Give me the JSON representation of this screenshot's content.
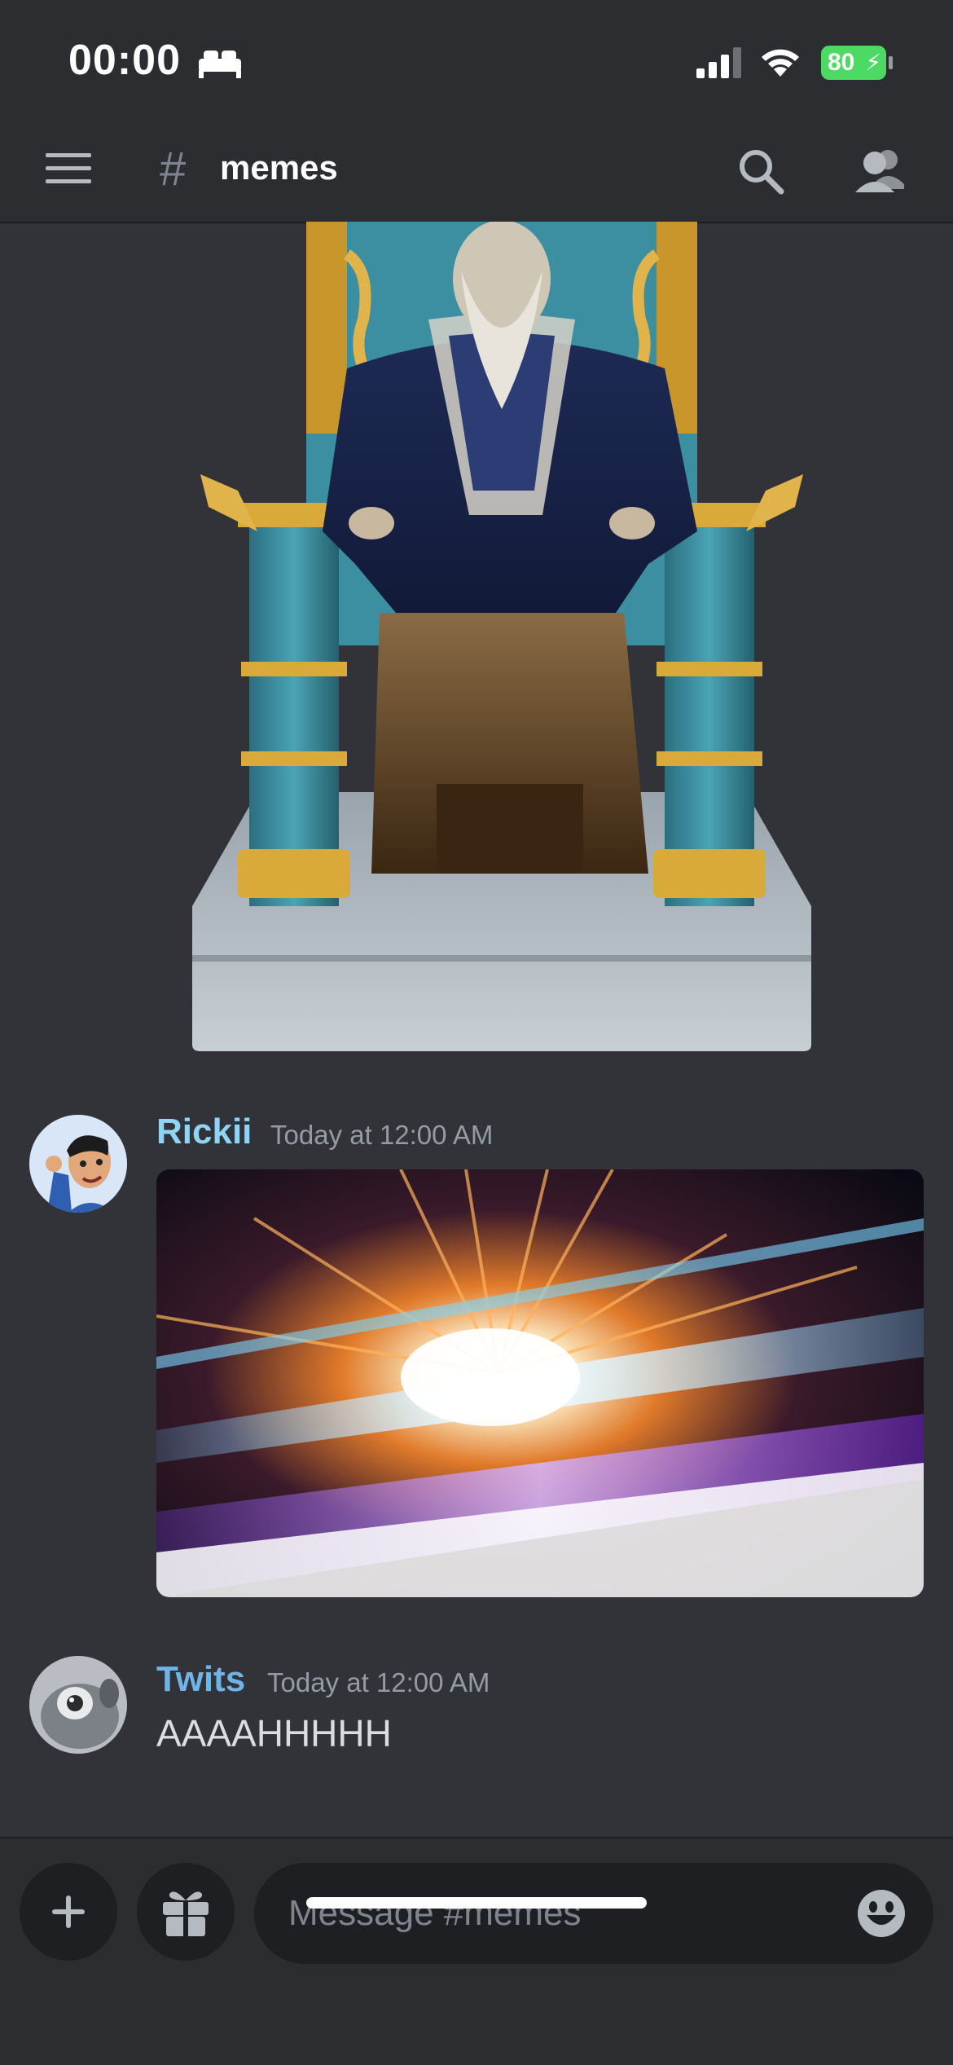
{
  "status_bar": {
    "time": "00:00",
    "battery": "80"
  },
  "header": {
    "hash": "#",
    "channel_name": "memes"
  },
  "messages": [
    {
      "author": "Rickii",
      "author_color": "#8fd3f5",
      "timestamp": "Today at 12:00 AM"
    },
    {
      "author": "Twits",
      "author_color": "#6fb4e8",
      "timestamp": "Today at 12:00 AM",
      "text": "AAAAHHHHH"
    }
  ],
  "composer": {
    "placeholder": "Message #memes"
  },
  "colors": {
    "background": "#313338",
    "header": "#2b2d31",
    "input": "#1e1f22",
    "battery": "#4cd964"
  }
}
